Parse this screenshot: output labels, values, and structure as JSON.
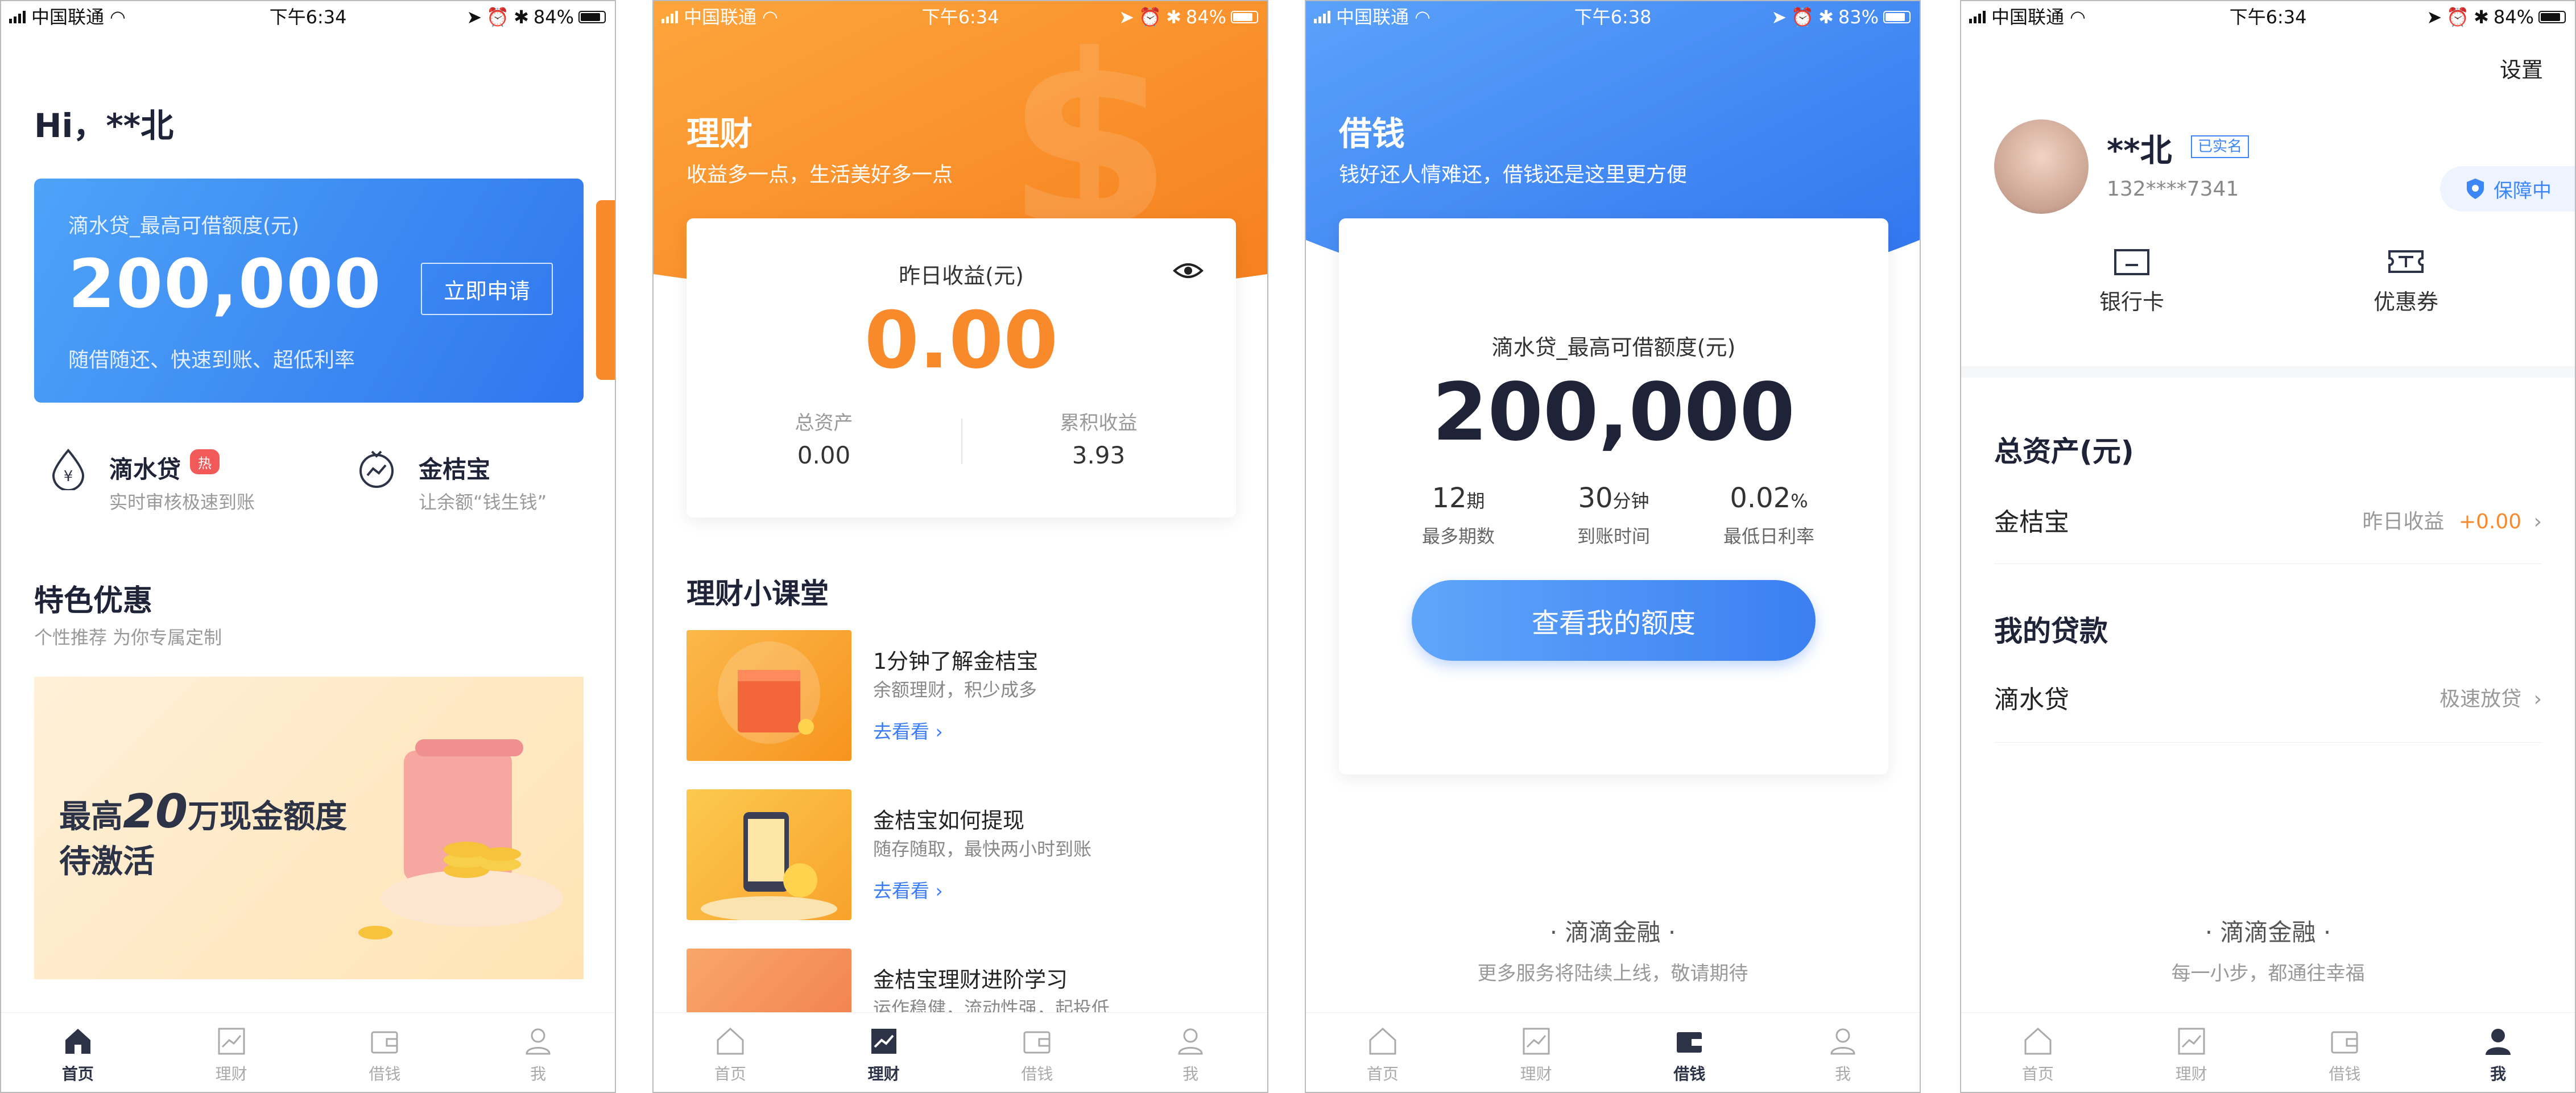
{
  "status_bars": [
    {
      "carrier": "中国联通",
      "time": "下午6:34",
      "battery": "84%"
    },
    {
      "carrier": "中国联通",
      "time": "下午6:34",
      "battery": "84%"
    },
    {
      "carrier": "中国联通",
      "time": "下午6:38",
      "battery": "83%"
    },
    {
      "carrier": "中国联通",
      "time": "下午6:34",
      "battery": "84%"
    }
  ],
  "tabs": {
    "home": "首页",
    "finance": "理财",
    "borrow": "借钱",
    "me": "我"
  },
  "home": {
    "greeting": "Hi，**北",
    "card": {
      "label": "滴水贷_最高可借额度(元)",
      "amount": "200,000",
      "apply_button": "立即申请",
      "subtitle": "随借随还、快速到账、超低利率"
    },
    "products": [
      {
        "name": "滴水贷",
        "badge": "热",
        "desc": "实时审核极速到账"
      },
      {
        "name": "金桔宝",
        "desc": "让余额“钱生钱”"
      }
    ],
    "featured": {
      "title": "特色优惠",
      "subtitle": "个性推荐 为你专属定制"
    },
    "banner": {
      "line1_prefix": "最高",
      "line1_number": "20",
      "line1_suffix": "万现金额度",
      "line2": "待激活"
    }
  },
  "finance": {
    "title": "理财",
    "subtitle": "收益多一点，生活美好多一点",
    "yesterday_label": "昨日收益(元)",
    "yesterday_value": "0.00",
    "total_assets_label": "总资产",
    "total_assets_value": "0.00",
    "cumulative_label": "累积收益",
    "cumulative_value": "3.93",
    "classroom_title": "理财小课堂",
    "courses": [
      {
        "title": "1分钟了解金桔宝",
        "subtitle": "余额理财，积少成多",
        "link": "去看看 ›"
      },
      {
        "title": "金桔宝如何提现",
        "subtitle": "随存随取，最快两小时到账",
        "link": "去看看 ›"
      },
      {
        "title": "金桔宝理财进阶学习",
        "subtitle": "运作稳健，流动性强，起投低"
      }
    ]
  },
  "borrow": {
    "title": "借钱",
    "subtitle": "钱好还人情难还，借钱还是这里更方便",
    "limit_label": "滴水贷_最高可借额度(元)",
    "limit_value": "200,000",
    "stats": [
      {
        "value": "12",
        "unit": "期",
        "label": "最多期数"
      },
      {
        "value": "30",
        "unit": "分钟",
        "label": "到账时间"
      },
      {
        "value": "0.02",
        "unit": "%",
        "label": "最低日利率"
      }
    ],
    "cta": "查看我的额度",
    "footer_title": "· 滴滴金融 ·",
    "footer_sub": "更多服务将陆续上线，敬请期待"
  },
  "me": {
    "settings": "设置",
    "name": "**北",
    "verified": "已实名",
    "phone": "132****7341",
    "protect": "保障中",
    "shortcuts": [
      {
        "label": "银行卡"
      },
      {
        "label": "优惠券"
      }
    ],
    "assets_title": "总资产(元)",
    "jinjubao": {
      "name": "金桔宝",
      "label": "昨日收益",
      "value": "+0.00"
    },
    "loans_title": "我的贷款",
    "loan": {
      "name": "滴水贷",
      "status": "极速放贷"
    },
    "footer_title": "· 滴滴金融 ·",
    "footer_sub": "每一小步，都通往幸福"
  },
  "colors": {
    "primary_blue": "#3c86f6",
    "orange": "#f98a2c",
    "navy": "#1f2337"
  }
}
